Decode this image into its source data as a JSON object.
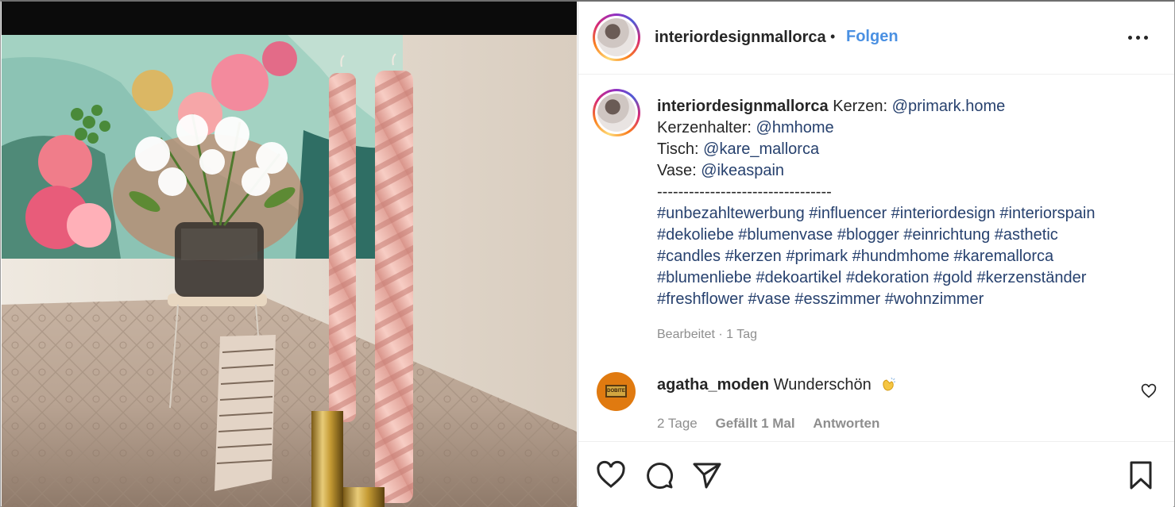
{
  "post": {
    "username": "interiordesignmallorca",
    "separator": "•",
    "follow_label": "Folgen",
    "more_icon": "more-horizontal-icon"
  },
  "caption": {
    "username": "interiordesignmallorca",
    "lines": [
      {
        "text": "Kerzen: ",
        "mention": "@primark.home"
      },
      {
        "text": "Kerzenhalter: ",
        "mention": "@hmhome"
      },
      {
        "text": "Tisch: ",
        "mention": "@kare_mallorca"
      },
      {
        "text": "Vase: ",
        "mention": "@ikeaspain"
      }
    ],
    "divider": "---------------------------------",
    "hashtag_lines": [
      "#unbezahltewerbung #influencer #interiordesign #interiorspain",
      "#dekoliebe #blumenvase #blogger #einrichtung #asthetic",
      "#candles #kerzen #primark #hundmhome #karemallorca",
      "#blumenliebe #dekoartikel #dekoration #gold #kerzenständer",
      "#freshflower #vase #esszimmer #wohnzimmer"
    ],
    "meta": "Bearbeitet · 1 Tag"
  },
  "comment": {
    "username": "agatha_moden",
    "text": "Wunderschön",
    "emoji": "clapping-hands-icon",
    "time": "2 Tage",
    "likes": "Gefällt 1 Mal",
    "reply_label": "Antworten"
  },
  "actions": {
    "like": "heart-icon",
    "comment": "comment-icon",
    "share": "send-icon",
    "save": "bookmark-icon"
  },
  "colors": {
    "follow": "#4a90e2",
    "hashtag": "#27416e",
    "muted": "#8e8e8e",
    "candle": "#f0b8ae"
  }
}
